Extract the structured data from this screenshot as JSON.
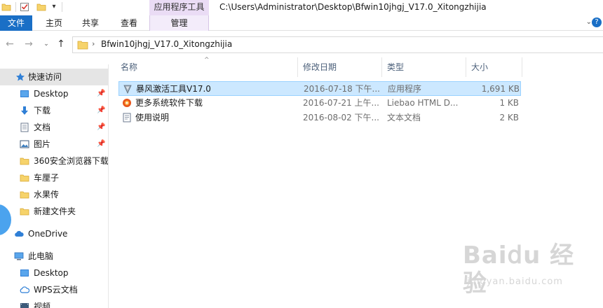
{
  "window": {
    "path_title": "C:\\Users\\Administrator\\Desktop\\Bfwin10jhgj_V17.0_Xitongzhijia",
    "context_group": "应用程序工具"
  },
  "ribbon": {
    "tabs": [
      {
        "label": "文件"
      },
      {
        "label": "主页"
      },
      {
        "label": "共享"
      },
      {
        "label": "查看"
      },
      {
        "label": "管理"
      }
    ],
    "help": "?"
  },
  "address": {
    "crumb": "Bfwin10jhgj_V17.0_Xitongzhijia"
  },
  "sidebar": {
    "items": [
      {
        "label": "快速访问",
        "icon": "star-icon",
        "pinned": false
      },
      {
        "label": "Desktop",
        "icon": "desktop-icon",
        "pinned": true
      },
      {
        "label": "下载",
        "icon": "download-icon",
        "pinned": true
      },
      {
        "label": "文档",
        "icon": "document-icon",
        "pinned": true
      },
      {
        "label": "图片",
        "icon": "picture-icon",
        "pinned": true
      },
      {
        "label": "360安全浏览器下载",
        "icon": "folder-icon",
        "pinned": false
      },
      {
        "label": "车厘子",
        "icon": "folder-icon",
        "pinned": false
      },
      {
        "label": "水果传",
        "icon": "folder-icon",
        "pinned": false
      },
      {
        "label": "新建文件夹",
        "icon": "folder-icon",
        "pinned": false
      },
      {
        "label": "OneDrive",
        "icon": "cloud-icon",
        "pinned": false
      },
      {
        "label": "此电脑",
        "icon": "computer-icon",
        "pinned": false
      },
      {
        "label": "Desktop",
        "icon": "desktop-icon",
        "pinned": false
      },
      {
        "label": "WPS云文档",
        "icon": "wps-cloud-icon",
        "pinned": false
      },
      {
        "label": "视频",
        "icon": "video-icon",
        "pinned": false
      }
    ]
  },
  "columns": {
    "name": "名称",
    "date": "修改日期",
    "type": "类型",
    "size": "大小"
  },
  "files": [
    {
      "name": "暴风激活工具V17.0",
      "date": "2016-07-18 下午...",
      "type": "应用程序",
      "size": "1,691 KB",
      "icon": "activator-app-icon"
    },
    {
      "name": "更多系统软件下载",
      "date": "2016-07-21 上午...",
      "type": "Liebao HTML D...",
      "size": "1 KB",
      "icon": "html-document-icon"
    },
    {
      "name": "使用说明",
      "date": "2016-08-02 下午...",
      "type": "文本文档",
      "size": "2 KB",
      "icon": "text-file-icon"
    }
  ],
  "watermark": {
    "main": "Bai𝖽u 经验",
    "sub": "jingyan.baidu.com"
  },
  "colors": {
    "file_tab": "#1a6fc6",
    "context_tab": "#eadcf5",
    "selection": "#cce8ff",
    "folder": "#f6d36b"
  }
}
